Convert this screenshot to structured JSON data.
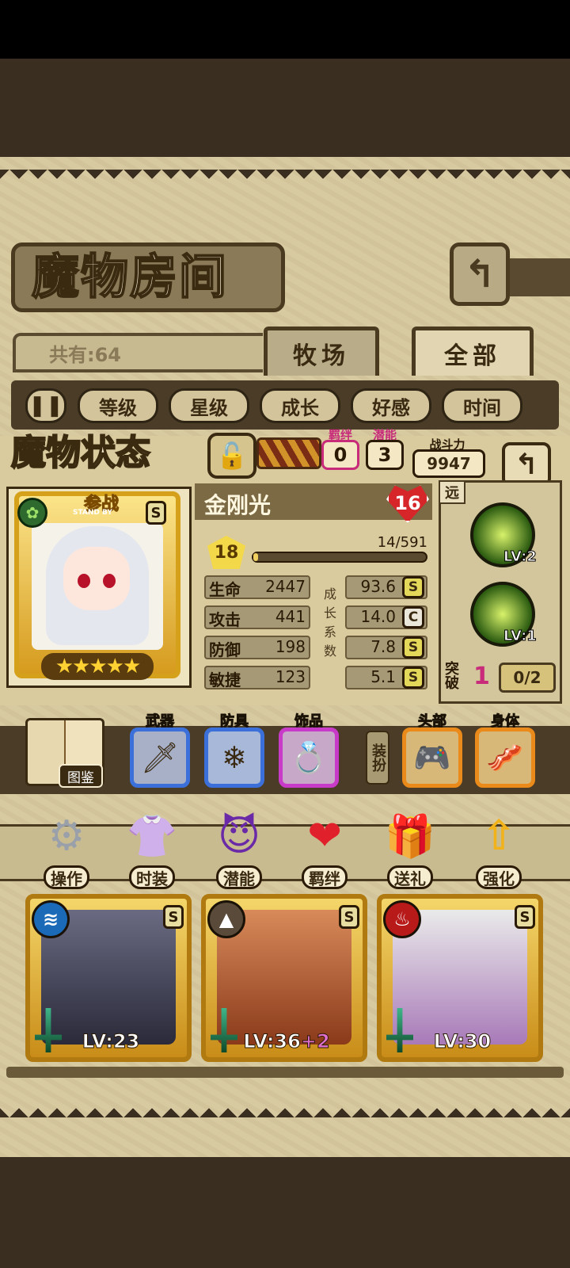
{
  "room": {
    "title": "魔物房间",
    "count_text": "共有:64",
    "back_icon": "back-arrow-icon"
  },
  "tabs": [
    {
      "label": "牧场"
    },
    {
      "label": "全部"
    }
  ],
  "sort": {
    "pause_icon": "pause-icon",
    "buttons": [
      {
        "label": "等级"
      },
      {
        "label": "星级"
      },
      {
        "label": "成长"
      },
      {
        "label": "好感"
      },
      {
        "label": "时间"
      }
    ]
  },
  "status": {
    "title": "魔物状态",
    "bond_label": "羁绊",
    "bond_value": "0",
    "potential_label": "潜能",
    "potential_value": "3",
    "power_label": "战斗力",
    "power_value": "9947"
  },
  "monster": {
    "name": "金刚光",
    "affection": "16",
    "standby_label": "参战",
    "standby_sub": "STAND BY",
    "rank_badge": "S",
    "stars": "★★★★★",
    "star_count": 5,
    "level": "18",
    "exp_text": "14/591",
    "exp_fraction": 0.024,
    "element_icon": "leaf-icon",
    "stats": [
      {
        "label": "生命",
        "value": "2447",
        "growth": "93.6",
        "grade": "S"
      },
      {
        "label": "攻击",
        "value": "441",
        "growth": "14.0",
        "grade": "C"
      },
      {
        "label": "防御",
        "value": "198",
        "growth": "7.8",
        "grade": "S"
      },
      {
        "label": "敏捷",
        "value": "123",
        "growth": "5.1",
        "grade": "S"
      }
    ],
    "growth_vertical": [
      "成",
      "长",
      "系",
      "数"
    ]
  },
  "skills": {
    "range_label": "远",
    "items": [
      {
        "level": "LV:2"
      },
      {
        "level": "LV:1"
      }
    ],
    "breakthrough_label": "突破",
    "breakthrough_value": "1",
    "breakthrough_progress": "0/2"
  },
  "equipment": {
    "codex_label": "图鉴",
    "dress_label": "装扮",
    "slots": [
      {
        "label": "武器",
        "icon": "sword-icon",
        "glyph": "🗡",
        "color": "#3b6fd9"
      },
      {
        "label": "防具",
        "icon": "crystal-icon",
        "glyph": "❄",
        "color": "#3b6fd9"
      },
      {
        "label": "饰品",
        "icon": "ring-icon",
        "glyph": "💍",
        "color": "#c83bc8"
      },
      {
        "label": "头部",
        "icon": "gamepad-icon",
        "glyph": "🎮",
        "color": "#e98a1a"
      },
      {
        "label": "身体",
        "icon": "sausage-icon",
        "glyph": "🥓",
        "color": "#e98a1a"
      }
    ]
  },
  "actions": [
    {
      "label": "操作",
      "icon": "gear-icon",
      "glyph": "⚙"
    },
    {
      "label": "时装",
      "icon": "outfit-icon",
      "glyph": "👚"
    },
    {
      "label": "潜能",
      "icon": "demon-icon",
      "glyph": "😈"
    },
    {
      "label": "羁绊",
      "icon": "hearts-icon",
      "glyph": "❤"
    },
    {
      "label": "送礼",
      "icon": "gift-icon",
      "glyph": "🎁"
    },
    {
      "label": "强化",
      "icon": "upgrade-arrows-icon",
      "glyph": "⇧"
    }
  ],
  "grid": [
    {
      "level": "LV:23",
      "bonus": "",
      "element_icon": "water-icon",
      "element_glyph": "≋",
      "rank": "S"
    },
    {
      "level": "LV:36",
      "bonus": "+2",
      "element_icon": "earth-icon",
      "element_glyph": "▲",
      "rank": "S"
    },
    {
      "level": "LV:30",
      "bonus": "",
      "element_icon": "fire-icon",
      "element_glyph": "🔥",
      "rank": "S"
    }
  ]
}
